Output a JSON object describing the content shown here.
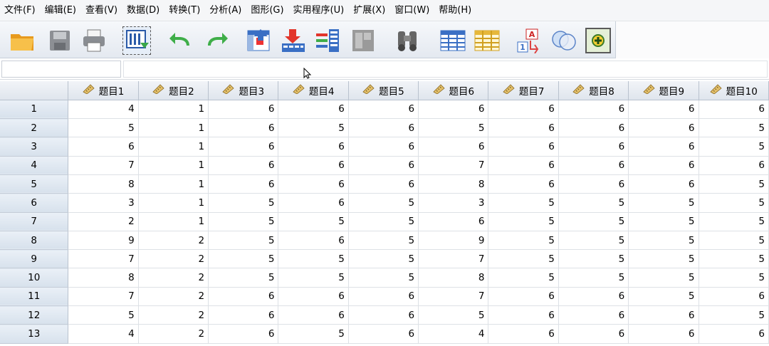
{
  "menu": [
    "文件(F)",
    "编辑(E)",
    "查看(V)",
    "数据(D)",
    "转换(T)",
    "分析(A)",
    "图形(G)",
    "实用程序(U)",
    "扩展(X)",
    "窗口(W)",
    "帮助(H)"
  ],
  "toolbar": {
    "icons": [
      "open-folder-icon",
      "save-icon",
      "print-icon",
      "import-data-icon",
      "undo-icon",
      "redo-icon",
      "goto-case-icon",
      "goto-variable-icon",
      "variables-icon",
      "run-descriptive-icon",
      "find-icon",
      "insert-cases-icon",
      "insert-variable-icon",
      "split-file-icon",
      "weight-cases-icon",
      "select-cases-icon",
      "value-labels-icon"
    ]
  },
  "cell_editor": {
    "reference": "",
    "value": ""
  },
  "grid": {
    "columns": [
      "题目1",
      "题目2",
      "题目3",
      "题目4",
      "题目5",
      "题目6",
      "题目7",
      "题目8",
      "题目9",
      "题目10"
    ],
    "rows": [
      {
        "id": "1",
        "cells": [
          "4",
          "1",
          "6",
          "6",
          "6",
          "6",
          "6",
          "6",
          "6",
          "6"
        ]
      },
      {
        "id": "2",
        "cells": [
          "5",
          "1",
          "6",
          "5",
          "6",
          "5",
          "6",
          "6",
          "6",
          "5"
        ]
      },
      {
        "id": "3",
        "cells": [
          "6",
          "1",
          "6",
          "6",
          "6",
          "6",
          "6",
          "6",
          "6",
          "5"
        ]
      },
      {
        "id": "4",
        "cells": [
          "7",
          "1",
          "6",
          "6",
          "6",
          "7",
          "6",
          "6",
          "6",
          "6"
        ]
      },
      {
        "id": "5",
        "cells": [
          "8",
          "1",
          "6",
          "6",
          "6",
          "8",
          "6",
          "6",
          "6",
          "5"
        ]
      },
      {
        "id": "6",
        "cells": [
          "3",
          "1",
          "5",
          "6",
          "5",
          "3",
          "5",
          "5",
          "5",
          "5"
        ]
      },
      {
        "id": "7",
        "cells": [
          "2",
          "1",
          "5",
          "5",
          "5",
          "6",
          "5",
          "5",
          "5",
          "5"
        ]
      },
      {
        "id": "8",
        "cells": [
          "9",
          "2",
          "5",
          "6",
          "5",
          "9",
          "5",
          "5",
          "5",
          "5"
        ]
      },
      {
        "id": "9",
        "cells": [
          "7",
          "2",
          "5",
          "5",
          "5",
          "7",
          "5",
          "5",
          "5",
          "5"
        ]
      },
      {
        "id": "10",
        "cells": [
          "8",
          "2",
          "5",
          "5",
          "5",
          "8",
          "5",
          "5",
          "5",
          "5"
        ]
      },
      {
        "id": "11",
        "cells": [
          "7",
          "2",
          "6",
          "6",
          "6",
          "7",
          "6",
          "6",
          "5",
          "6"
        ]
      },
      {
        "id": "12",
        "cells": [
          "5",
          "2",
          "6",
          "6",
          "6",
          "5",
          "6",
          "6",
          "6",
          "5"
        ]
      },
      {
        "id": "13",
        "cells": [
          "4",
          "2",
          "6",
          "5",
          "6",
          "4",
          "6",
          "6",
          "6",
          "6"
        ]
      }
    ]
  }
}
